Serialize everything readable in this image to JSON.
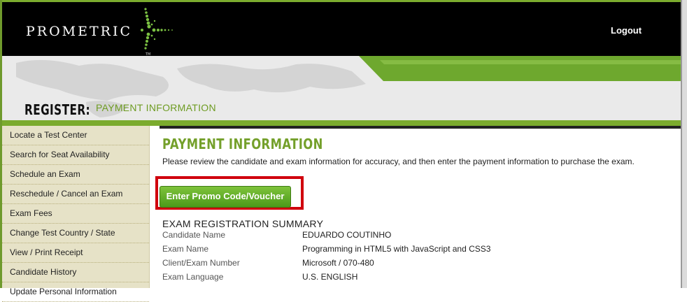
{
  "header": {
    "logo_text": "PROMETRIC",
    "logout_label": "Logout"
  },
  "page": {
    "register_label": "REGISTER:",
    "section_label": "PAYMENT INFORMATION"
  },
  "sidebar": {
    "items": [
      {
        "label": "Locate a Test Center"
      },
      {
        "label": "Search for Seat Availability"
      },
      {
        "label": "Schedule an Exam"
      },
      {
        "label": "Reschedule / Cancel an Exam"
      },
      {
        "label": "Exam Fees"
      },
      {
        "label": "Change Test Country / State"
      },
      {
        "label": "View / Print Receipt"
      },
      {
        "label": "Candidate History"
      },
      {
        "label": "Update Personal Information"
      }
    ]
  },
  "main": {
    "title": "PAYMENT INFORMATION",
    "intro": "Please review the candidate and exam information for accuracy, and then enter the payment information to purchase the exam.",
    "promo_button_label": "Enter Promo Code/Voucher",
    "summary_title": "EXAM REGISTRATION SUMMARY",
    "summary": [
      {
        "label": "Candidate Name",
        "value": "EDUARDO COUTINHO"
      },
      {
        "label": "Exam Name",
        "value": "Programming in HTML5 with JavaScript and CSS3"
      },
      {
        "label": "Client/Exam Number",
        "value": "Microsoft / 070-480"
      },
      {
        "label": "Exam Language",
        "value": "U.S. ENGLISH"
      }
    ]
  },
  "colors": {
    "brand_green": "#7bab2e",
    "highlight_red": "#d0000d",
    "sidebar_bg": "#e6e2c7"
  }
}
